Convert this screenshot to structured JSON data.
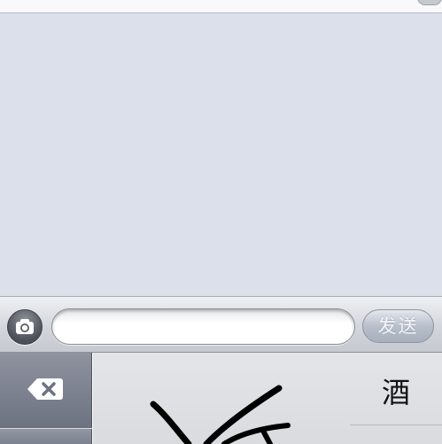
{
  "composer": {
    "message_value": "",
    "send_label": "发送"
  },
  "keyboard": {
    "candidates": [
      "酒"
    ]
  },
  "icons": {
    "camera": "camera-icon",
    "delete": "backspace-icon"
  },
  "colors": {
    "background": "#dbe0eb",
    "send_button": "#b8bfcb",
    "delete_key": "#7d8290",
    "ink": "#000000"
  }
}
